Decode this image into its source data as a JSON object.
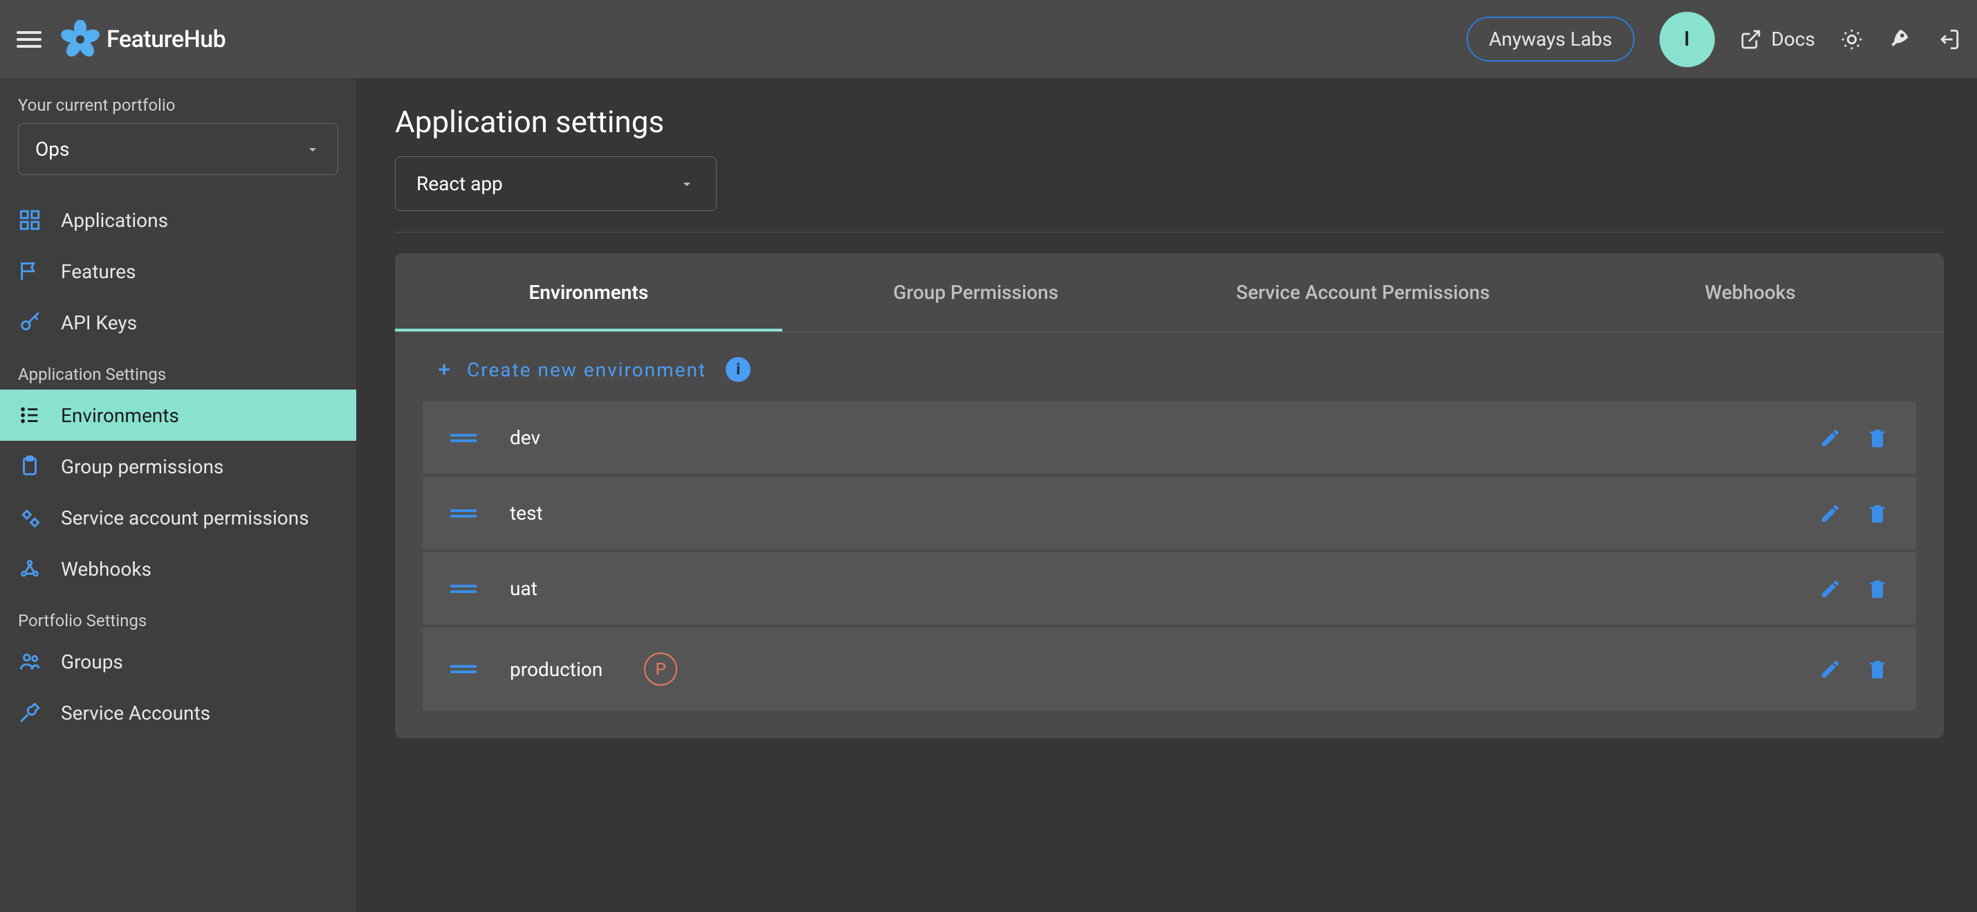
{
  "header": {
    "brand": "FeatureHub",
    "org": "Anyways Labs",
    "avatar_initial": "I",
    "docs_label": "Docs"
  },
  "sidebar": {
    "portfolio_label": "Your current portfolio",
    "portfolio_value": "Ops",
    "nav": {
      "applications": "Applications",
      "features": "Features",
      "api_keys": "API Keys"
    },
    "app_settings_label": "Application Settings",
    "app_settings": {
      "environments": "Environments",
      "group_permissions": "Group permissions",
      "service_account_permissions": "Service account permissions",
      "webhooks": "Webhooks"
    },
    "portfolio_settings_label": "Portfolio Settings",
    "portfolio_settings": {
      "groups": "Groups",
      "service_accounts": "Service Accounts"
    }
  },
  "main": {
    "title": "Application settings",
    "app_select_value": "React app",
    "tabs": {
      "environments": "Environments",
      "group_permissions": "Group Permissions",
      "service_account_permissions": "Service Account Permissions",
      "webhooks": "Webhooks"
    },
    "create_label": "Create new environment",
    "prod_badge": "P",
    "environments": [
      {
        "name": "dev",
        "production": false
      },
      {
        "name": "test",
        "production": false
      },
      {
        "name": "uat",
        "production": false
      },
      {
        "name": "production",
        "production": true
      }
    ]
  }
}
